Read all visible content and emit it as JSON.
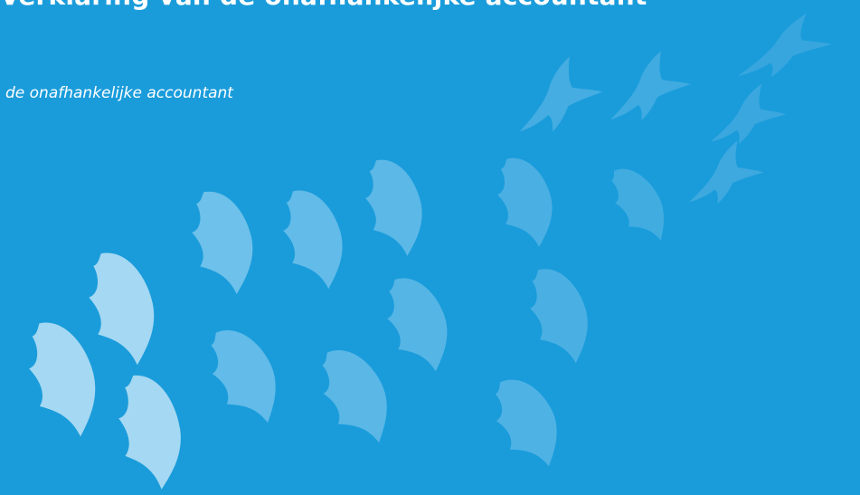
{
  "document": {
    "title": "Verklaring van de onafhankelijke accountant",
    "subtitle": "de onafhankelijke accountant"
  },
  "colors": {
    "background": "#1a9cdb",
    "bird_light": "#a5d8f2",
    "bird_mid": "#62bbe8",
    "bird_dim": "#4aafe2",
    "bird_faint": "#3ba7df",
    "text": "#ffffff"
  },
  "decoration": {
    "icon": "flock-of-birds-illustration"
  }
}
